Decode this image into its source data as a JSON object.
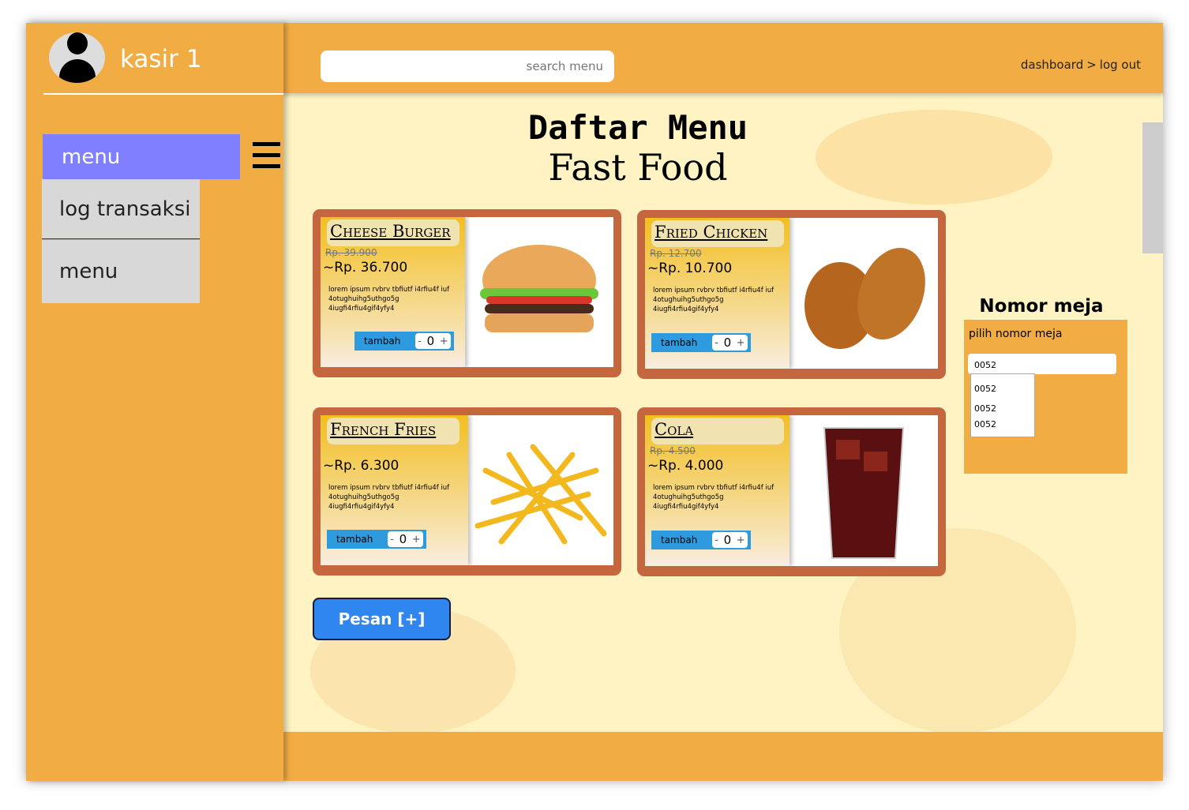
{
  "user": {
    "name": "kasir 1",
    "icon": "user-avatar-icon"
  },
  "sidebar": {
    "items": [
      {
        "label": "menu"
      },
      {
        "label": "log transaksi"
      },
      {
        "label": "menu"
      }
    ]
  },
  "header": {
    "search_placeholder": "search menu",
    "breadcrumb": [
      "dashboard",
      ">",
      "log out"
    ]
  },
  "main": {
    "title": "Daftar Menu",
    "subtitle": "Fast Food",
    "items": [
      {
        "name": "Cheese Burger",
        "old_price": "Rp. 39.900",
        "price": "~Rp. 36.700",
        "desc": "lorem ipsum rvbrv tbfiutf i4rfiu4f iuf 4otughuihg5uthgo5g 4iugfi4rfiu4gif4yfy4",
        "add": "tambah",
        "qty": "0"
      },
      {
        "name": "Fried Chicken",
        "old_price": "Rp. 12.700",
        "price": "~Rp. 10.700",
        "desc": "lorem ipsum rvbrv tbfiutf i4rfiu4f iuf 4otughuihg5uthgo5g 4iugfi4rfiu4gif4yfy4",
        "add": "tambah",
        "qty": "0"
      },
      {
        "name": "French Fries",
        "price": "~Rp. 6.300",
        "desc": "lorem ipsum rvbrv tbfiutf i4rfiu4f iuf 4otughuihg5uthgo5g 4iugfi4rfiu4gif4yfy4",
        "add": "tambah",
        "qty": "0"
      },
      {
        "name": "Cola",
        "old_price": "Rp. 4.500",
        "price": "~Rp. 4.000",
        "desc": "lorem ipsum rvbrv tbfiutf i4rfiu4f iuf 4otughuihg5uthgo5g 4iugfi4rfiu4gif4yfy4",
        "add": "tambah",
        "qty": "0"
      }
    ],
    "order_button": "Pesan [+]"
  },
  "table": {
    "title": "Nomor meja",
    "label": "pilih nomor meja",
    "selected": "0052",
    "options": [
      "0052",
      "0052",
      "0052"
    ]
  },
  "step": {
    "minus": "-",
    "plus": "+"
  }
}
